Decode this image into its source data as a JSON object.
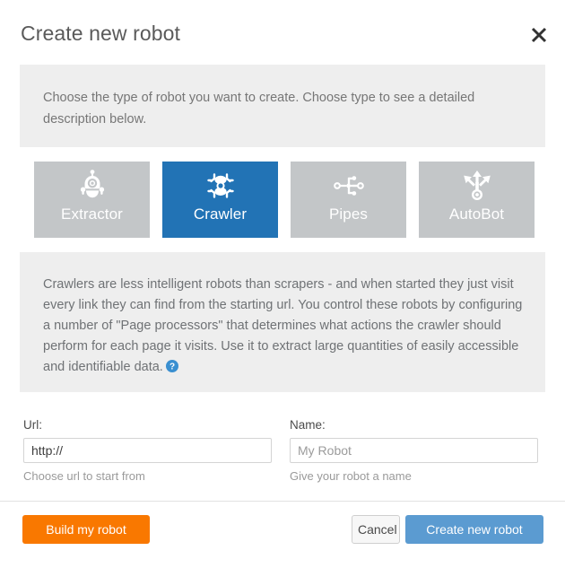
{
  "header": {
    "title": "Create new robot",
    "close_icon": "close-icon"
  },
  "intro": {
    "text": "Choose the type of robot you want to create. Choose type to see a detailed description below."
  },
  "robot_types": {
    "selected": "Crawler",
    "cards": [
      {
        "label": "Extractor",
        "icon": "robot-icon",
        "selected": false
      },
      {
        "label": "Crawler",
        "icon": "spider-icon",
        "selected": true
      },
      {
        "label": "Pipes",
        "icon": "sitemap-icon",
        "selected": false
      },
      {
        "label": "AutoBot",
        "icon": "trident-arrows-icon",
        "selected": false
      }
    ]
  },
  "description": {
    "text": "Crawlers are less intelligent robots than scrapers - and when started they just visit every link they can find from the starting url. You control these robots by configuring a number of \"Page processors\" that determines what actions the crawler should perform for each page it visits. Use it to extract large quantities of easily accessible and identifiable data.",
    "help_icon": "help-circle-icon"
  },
  "form": {
    "url": {
      "label": "Url:",
      "value": "http://",
      "placeholder": "",
      "help": "Choose url to start from"
    },
    "name": {
      "label": "Name:",
      "value": "",
      "placeholder": "My Robot",
      "help": "Give your robot a name"
    }
  },
  "footer": {
    "build_label": "Build my robot",
    "cancel_label": "Cancel",
    "create_label": "Create new robot"
  },
  "colors": {
    "selected_card": "#2273b5",
    "card_default": "#c3c6c8",
    "panel_bg": "#eeeeee",
    "build_button": "#f97800",
    "create_button": "#5b9bd1",
    "help_icon": "#3a8fd0"
  }
}
